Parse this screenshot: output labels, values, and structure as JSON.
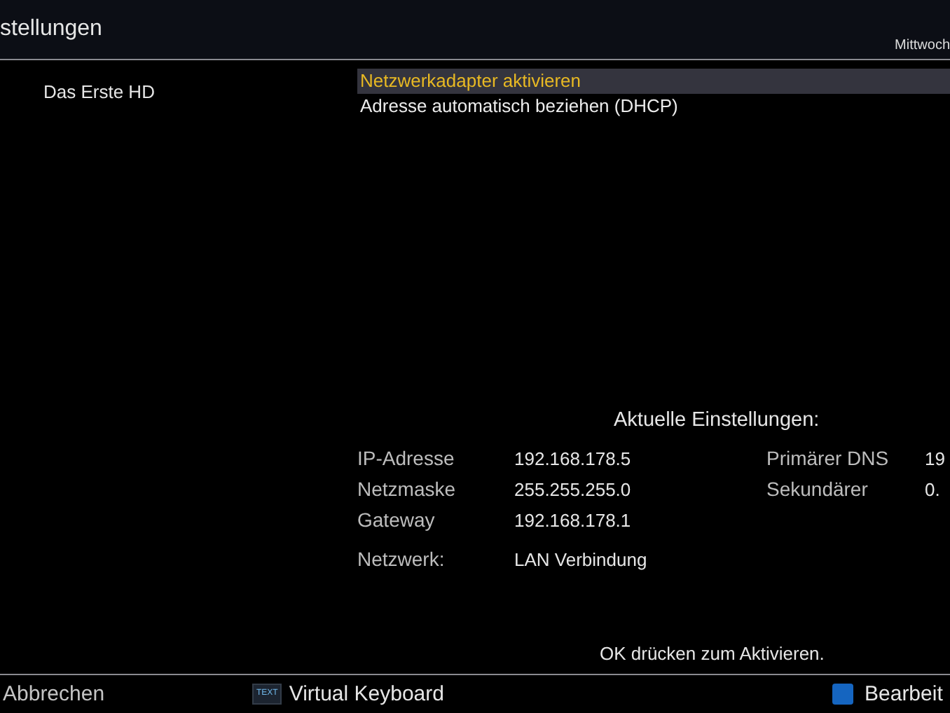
{
  "header": {
    "title": "stellungen",
    "date": "Mittwoch"
  },
  "channel": "Das Erste HD",
  "menu": [
    {
      "label": "Netzwerkadapter aktivieren",
      "selected": true
    },
    {
      "label": "Adresse automatisch beziehen (DHCP)",
      "selected": false
    }
  ],
  "current": {
    "heading": "Aktuelle Einstellungen:",
    "rows": [
      {
        "label": "IP-Adresse",
        "value": "192.168.178.5"
      },
      {
        "label": "Netzmaske",
        "value": "255.255.255.0"
      },
      {
        "label": "Gateway",
        "value": "192.168.178.1"
      }
    ],
    "dns": [
      {
        "label": "Primärer DNS",
        "value": "19"
      },
      {
        "label": "Sekundärer",
        "value": "0."
      }
    ],
    "network": {
      "label": "Netzwerk:",
      "value": "LAN Verbindung"
    }
  },
  "hint": "OK drücken zum Aktivieren.",
  "footer": [
    {
      "kind": "plain",
      "label": "Abbrechen"
    },
    {
      "kind": "text-key",
      "key": "TEXT",
      "label": "Virtual Keyboard"
    },
    {
      "kind": "color-key",
      "color": "#1565c0",
      "label": "Bearbeit"
    }
  ]
}
